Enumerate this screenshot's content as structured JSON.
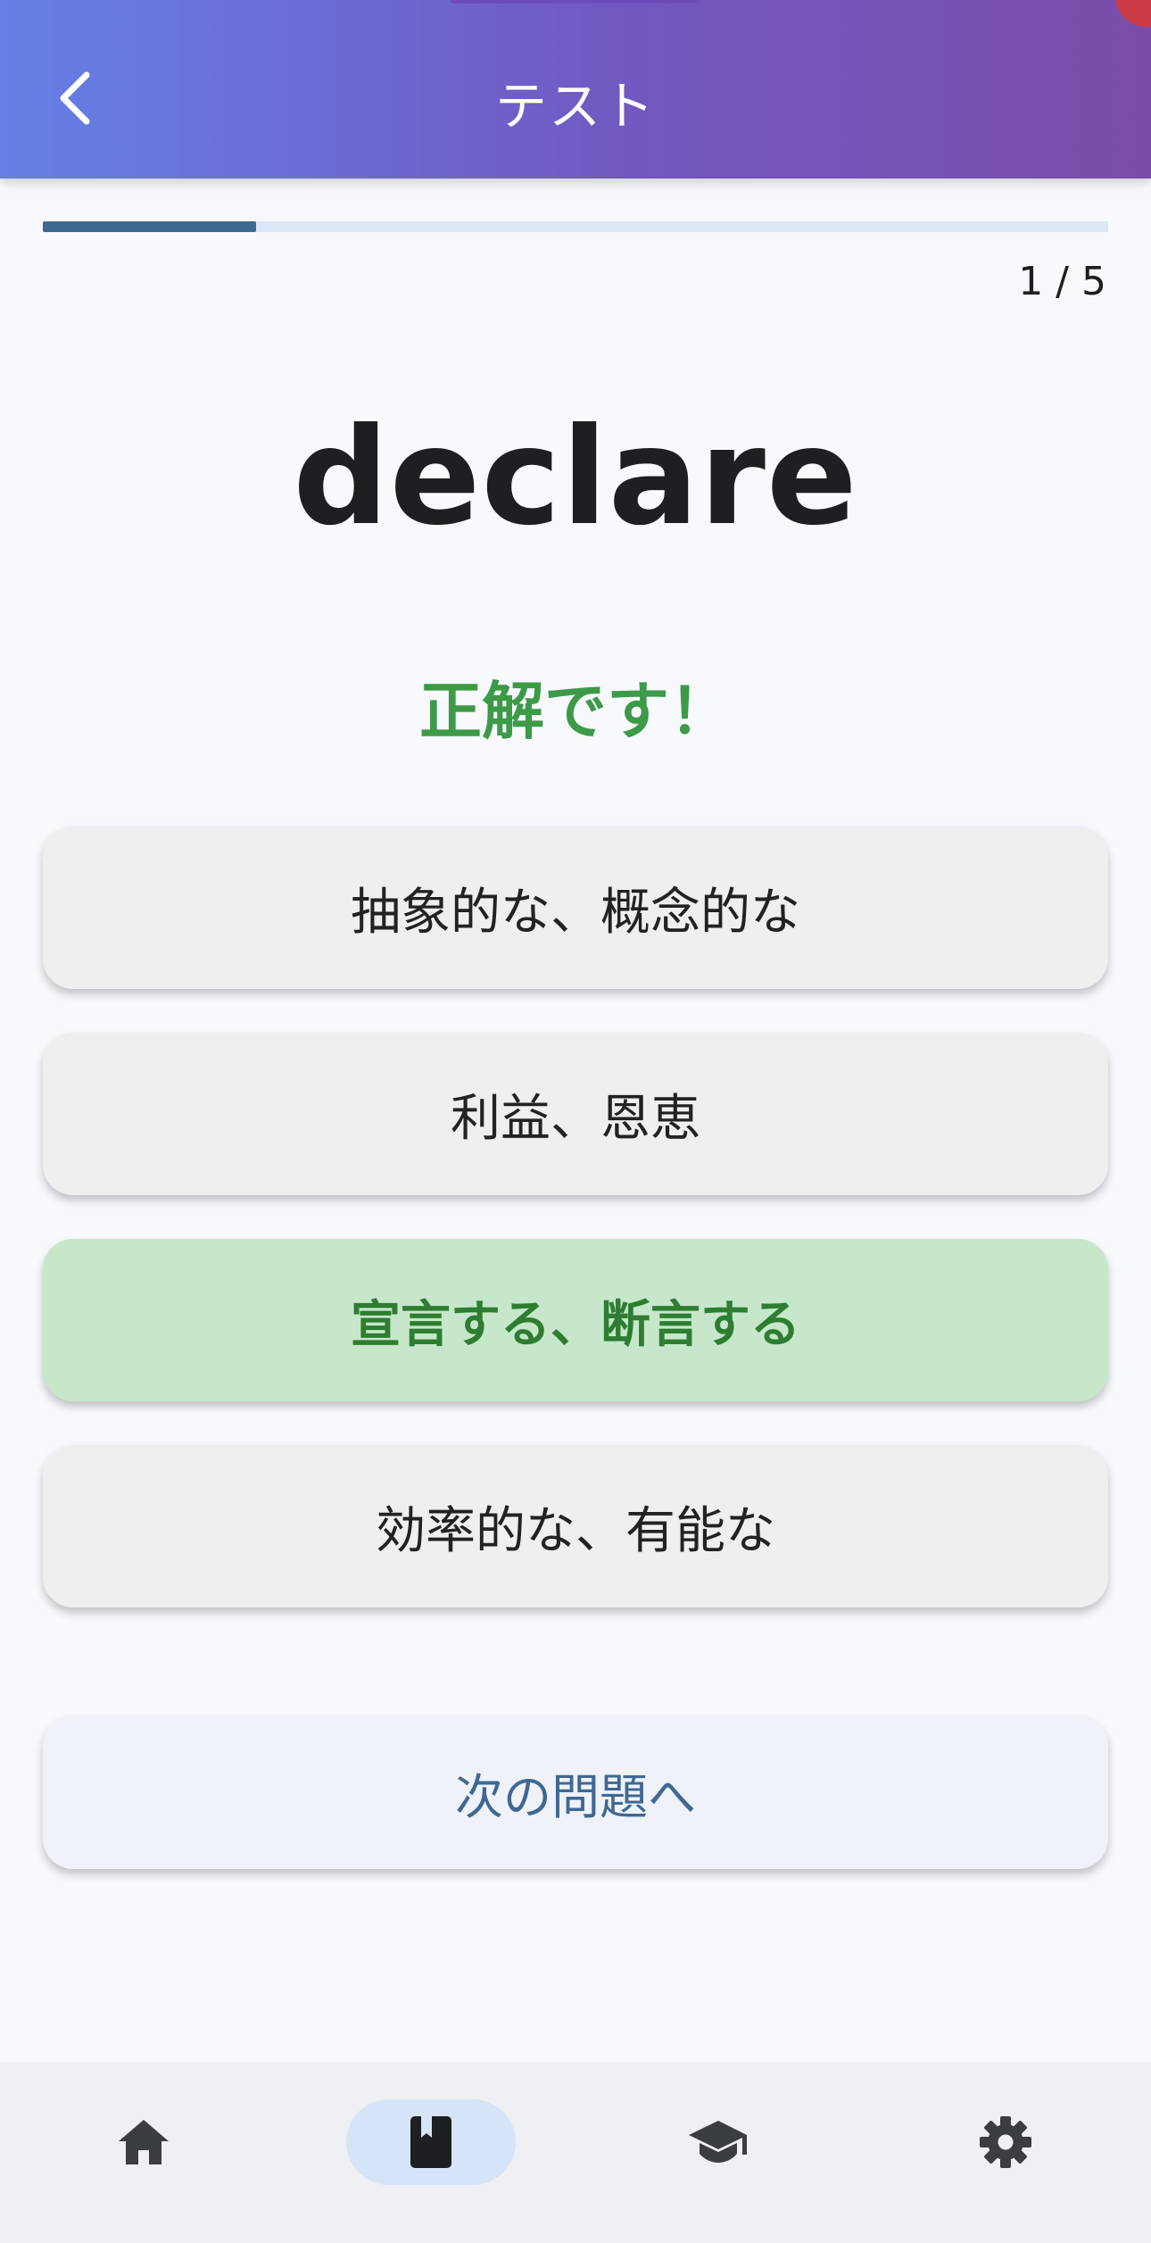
{
  "app_bar": {
    "title": "テスト",
    "back_icon": "chevron-left-icon"
  },
  "progress": {
    "current": 1,
    "total": 5,
    "fraction": 0.2,
    "label": "1 / 5"
  },
  "question": {
    "word": "declare"
  },
  "feedback": {
    "text": "正解です！",
    "color": "#3d9a47"
  },
  "options": [
    {
      "label": "抽象的な、概念的な",
      "state": "default"
    },
    {
      "label": "利益、恩恵",
      "state": "default"
    },
    {
      "label": "宣言する、断言する",
      "state": "correct"
    },
    {
      "label": "効率的な、有能な",
      "state": "default"
    }
  ],
  "next_button": {
    "label": "次の問題へ"
  },
  "bottom_nav": {
    "items": [
      {
        "icon": "home-icon",
        "active": false
      },
      {
        "icon": "book-icon",
        "active": true
      },
      {
        "icon": "graduation-cap-icon",
        "active": false
      },
      {
        "icon": "gear-icon",
        "active": false
      }
    ]
  },
  "colors": {
    "header_gradient_start": "#6580e6",
    "header_gradient_end": "#7a4da8",
    "progress_fill": "#3f6892",
    "progress_track": "#dbe6f6",
    "correct_bg": "#c7e7ca",
    "correct_text": "#2e7d32",
    "nav_active_bg": "#d6e4f7"
  }
}
